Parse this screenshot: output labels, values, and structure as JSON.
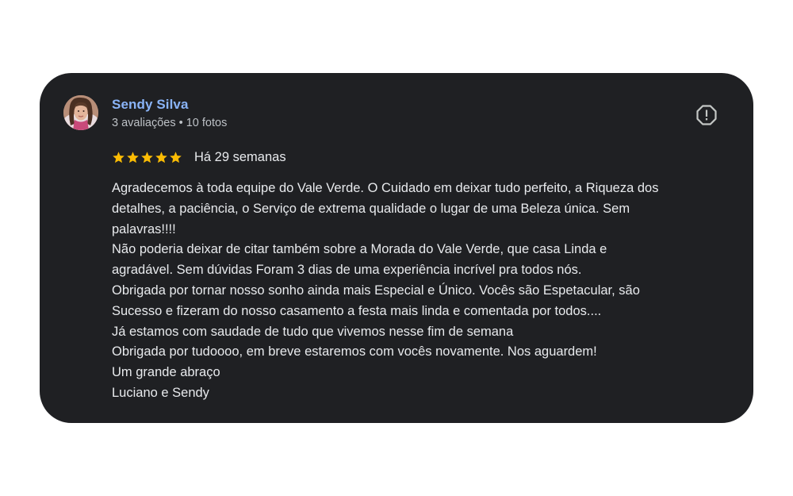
{
  "review": {
    "author": {
      "name": "Sendy Silva",
      "meta": "3 avaliações • 10 fotos",
      "avatar_icon": "user-photo"
    },
    "rating": {
      "stars": 5,
      "max": 5,
      "star_color": "#fbbc04",
      "date": "Há 29 semanas"
    },
    "report_icon": "exclamation-circle-icon",
    "text_lines": [
      "Agradecemos à toda equipe do Vale Verde. O Cuidado em deixar tudo perfeito, a Riqueza dos",
      "detalhes, a paciência, o Serviço de extrema qualidade o lugar de uma Beleza única. Sem",
      "palavras!!!!",
      "Não poderia deixar de citar também sobre a Morada do Vale Verde, que casa Linda e",
      "agradável. Sem dúvidas Foram 3 dias de uma experiência incrível pra todos nós.",
      "Obrigada por tornar nosso sonho ainda mais Especial e Único. Vocês são Espetacular, são",
      "Sucesso e fizeram do nosso casamento a festa mais linda e comentada por todos....",
      "Já estamos com saudade de tudo que vivemos nesse fim de semana",
      "Obrigada por tudoooo, em breve estaremos com vocês novamente. Nos aguardem!",
      "Um grande abraço",
      "Luciano e Sendy"
    ]
  },
  "colors": {
    "card_background": "#1f2023",
    "author_name": "#8ab4f8",
    "text": "#e8eaed",
    "secondary_text": "#bdc1c6"
  }
}
